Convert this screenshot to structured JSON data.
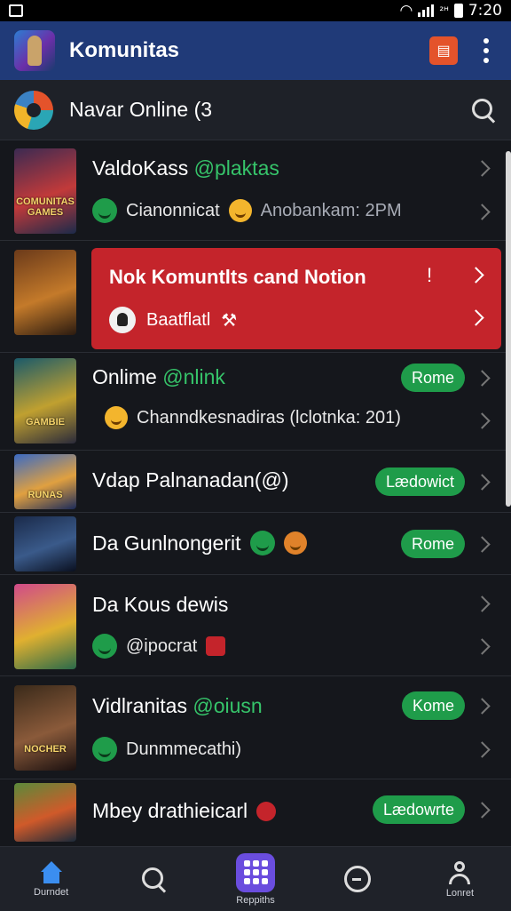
{
  "status_bar": {
    "time": "7:20",
    "indicator": "²ᴴ"
  },
  "app_bar": {
    "title": "Komunitas",
    "notif_icon": "▤"
  },
  "subheader": {
    "title": "Navar Online (3"
  },
  "rows": [
    {
      "title_a": "ValdoKass ",
      "title_b": "@plaktas",
      "sub_a": "Cianonnicat",
      "sub_b": "Anobankam: 2PM",
      "thumb_text": "COMUNITAS GAMES",
      "thumb_colors": [
        "#3b2a52",
        "#c23a3a",
        "#1b2a4a"
      ]
    },
    {
      "title": "Nok Komuntlts cand Notion",
      "mark": "!",
      "sub": "Baatflatl",
      "thumb_text": "",
      "thumb_colors": [
        "#6b3a1a",
        "#c47a2a",
        "#2a1a10"
      ]
    },
    {
      "title_a": "Onlime ",
      "title_b": "@nlink",
      "pill": "Rome",
      "sub": "Channdkesnadiras (lclotnka: 201)",
      "thumb_text": "GAMBIE",
      "thumb_colors": [
        "#1a5a6a",
        "#c0a030",
        "#2a2a3a"
      ]
    },
    {
      "title": "Vdap Palnanadan(@)",
      "pill": "Lædowict",
      "thumb_text": "RUNAS",
      "thumb_colors": [
        "#3a6ac4",
        "#e0a040",
        "#1a2a5a"
      ]
    },
    {
      "title": "Da Gunlnongerit",
      "pill": "Rome",
      "thumb_text": "",
      "thumb_colors": [
        "#1a2a4a",
        "#3a5a8a",
        "#0a1020"
      ]
    },
    {
      "title": "Da Kous dewis",
      "sub": "@ipocrat",
      "thumb_text": "",
      "thumb_colors": [
        "#d04a8a",
        "#e0b030",
        "#2a6a4a"
      ]
    },
    {
      "title_a": "Vidlranitas ",
      "title_b": "@oiusn",
      "pill": "Kome",
      "sub": "Dunmmecathi)",
      "thumb_text": "NOCHER",
      "thumb_colors": [
        "#3a2a1a",
        "#8a5a3a",
        "#1a1010"
      ]
    },
    {
      "title": "Mbey drathieicarl",
      "pill": "Lædowrte",
      "thumb_text": "",
      "thumb_colors": [
        "#5a8a3a",
        "#d05a2a",
        "#1a2a3a"
      ]
    }
  ],
  "bottom_nav": [
    {
      "label": "Durndet"
    },
    {
      "label": ""
    },
    {
      "label": "Reppiths"
    },
    {
      "label": ""
    },
    {
      "label": "Lonret"
    }
  ]
}
